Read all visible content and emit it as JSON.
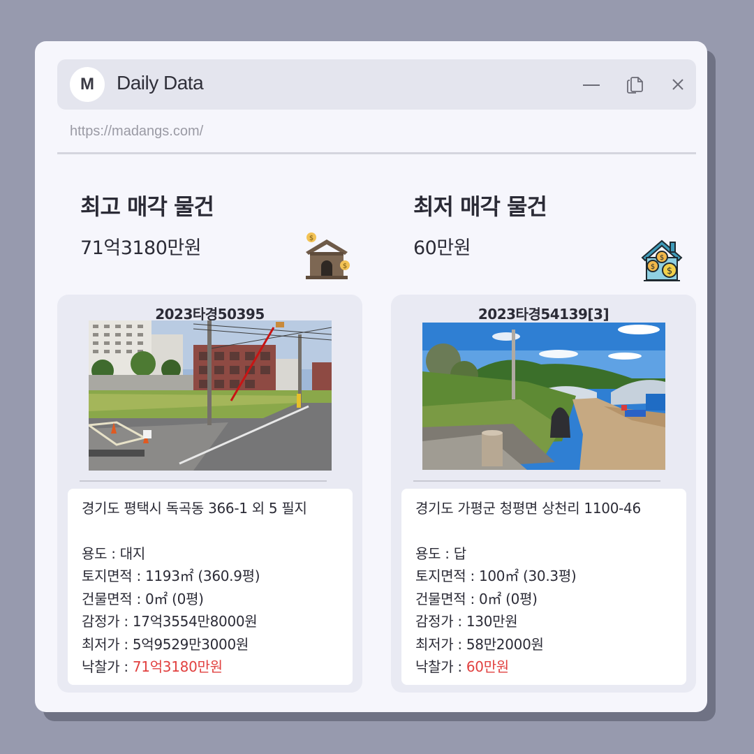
{
  "window": {
    "logo_letter": "M",
    "title": "Daily Data",
    "url": "https://madangs.com/"
  },
  "highest": {
    "heading": "최고 매각 물건",
    "price": "71억3180만원",
    "case_no": "2023타경50395",
    "address": "경기도 평택시 독곡동 366-1 외 5 필지",
    "use_label": "용도 : ",
    "use_value": "대지",
    "land_label": "토지면적 : ",
    "land_value": "1193㎡ (360.9평)",
    "building_label": "건물면적 : ",
    "building_value": "0㎡ (0평)",
    "appraisal_label": "감정가 : ",
    "appraisal_value": "17억3554만8000원",
    "minimum_label": "최저가 : ",
    "minimum_value": "5억9529만3000원",
    "winning_label": "낙찰가 : ",
    "winning_value": "71억3180만원",
    "photo": "street-lot-photo",
    "deco_icon": "house-coins-icon"
  },
  "lowest": {
    "heading": "최저 매각 물건",
    "price": "60만원",
    "case_no": "2023타경54139[3]",
    "address": "경기도 가평군 청평면 상천리 1100-46",
    "use_label": "용도 : ",
    "use_value": " 답",
    "land_label": "토지면적 : ",
    "land_value": "100㎡ (30.3평)",
    "building_label": "건물면적 : ",
    "building_value": "0㎡ (0평)",
    "appraisal_label": "감정가 : ",
    "appraisal_value": "130만원",
    "minimum_label": "최저가 : ",
    "minimum_value": "58만2000원",
    "winning_label": "낙찰가 : ",
    "winning_value": "60만원",
    "photo": "rural-field-photo",
    "deco_icon": "house-dollar-icon"
  },
  "colors": {
    "background": "#979aae",
    "window": "#f6f6fc",
    "titlebar": "#e4e5ee",
    "card": "#e9eaf3",
    "highlight": "#e1403f"
  },
  "icons": [
    "minimize-icon",
    "copy-icon",
    "close-icon"
  ]
}
